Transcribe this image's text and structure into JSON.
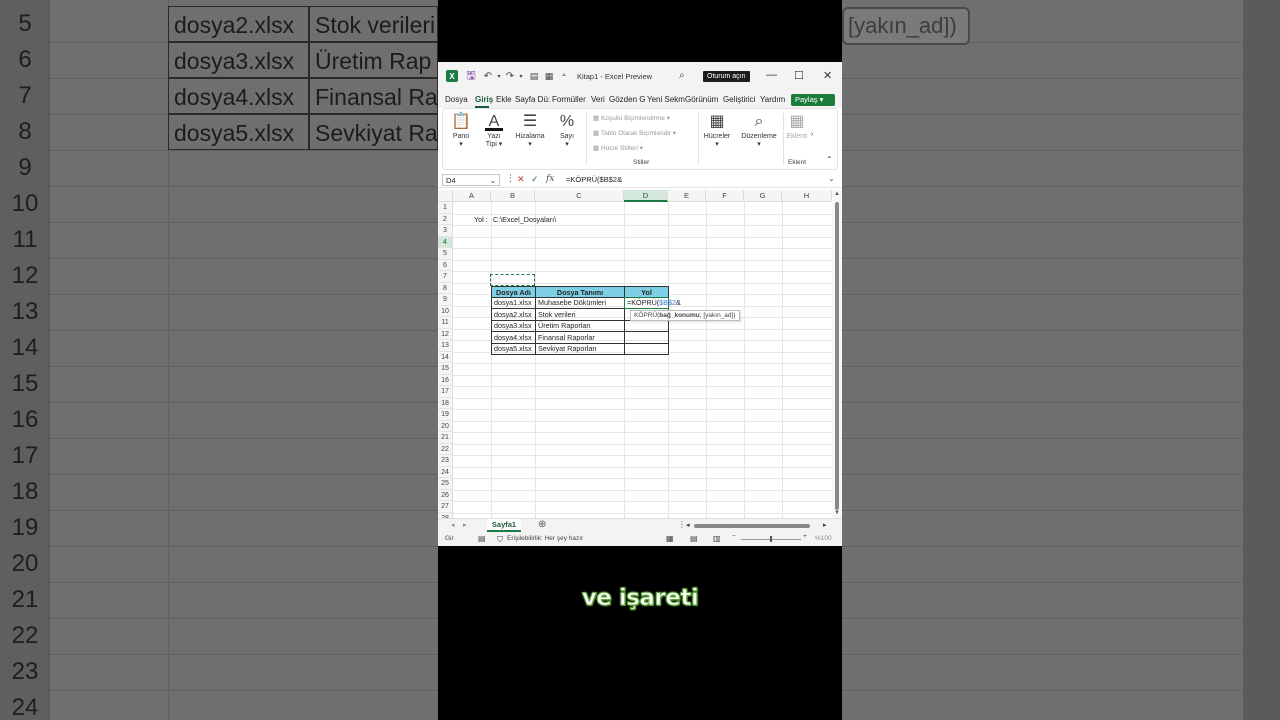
{
  "background": {
    "row_numbers": [
      "5",
      "6",
      "7",
      "8",
      "9",
      "10",
      "11",
      "12",
      "13",
      "14",
      "15",
      "16",
      "17",
      "18",
      "19",
      "20",
      "21",
      "22",
      "23",
      "24"
    ],
    "rows": [
      {
        "file": "dosya2.xlsx",
        "desc": "Stok verileri"
      },
      {
        "file": "dosya3.xlsx",
        "desc": "Üretim Rap"
      },
      {
        "file": "dosya4.xlsx",
        "desc": "Finansal Ra"
      },
      {
        "file": "dosya5.xlsx",
        "desc": "Sevkiyat Ra"
      }
    ],
    "tooltip_fragment": "[yakın_ad])"
  },
  "titlebar": {
    "title": "Kitap1  -  Excel Preview",
    "signin_label": "Oturum açın",
    "minimize": "—",
    "maximize": "☐",
    "close": "✕"
  },
  "menu": {
    "items": [
      "Dosya",
      "Giriş",
      "Ekle",
      "Sayfa Dü:",
      "Formüller",
      "Veri",
      "Gözden G",
      "Yeni Sekm",
      "Görünüm",
      "Geliştirici",
      "Yardım"
    ],
    "share_label": "Paylaş"
  },
  "ribbon": {
    "pano": "Pano",
    "yazi_tipi": "Yazı Tipi",
    "hizalama": "Hizalama",
    "sayi": "Sayı",
    "kosullu": "Koşullu Biçimlendirme",
    "tablo": "Tablo Olarak Biçimlendir",
    "hucre_stilleri": "Hücre Stilleri",
    "stiller": "Stiller",
    "hucreler": "Hücreler",
    "duzenleme": "Düzenleme",
    "eklenti": "Eklenti",
    "eklentiler": "Eklent"
  },
  "formula_bar": {
    "name_box": "D4",
    "formula": "=KÖPRÜ($B$2&"
  },
  "grid": {
    "columns": [
      "A",
      "B",
      "C",
      "D",
      "E",
      "F",
      "G",
      "H"
    ],
    "rows": [
      "1",
      "2",
      "3",
      "4",
      "5",
      "6",
      "7",
      "8",
      "9",
      "10",
      "11",
      "12",
      "13",
      "14",
      "15",
      "16",
      "17",
      "18",
      "19",
      "20",
      "21",
      "22",
      "23",
      "24",
      "25",
      "26",
      "27",
      "28"
    ],
    "yol_label": "Yol :",
    "path_value": "C:\\Excel_Dosyaları\\",
    "table_headers": [
      "Dosya Adı",
      "Dosya Tanımı",
      "Yol"
    ],
    "table_rows": [
      {
        "file": "dosya1.xlsx",
        "desc": "Muhasebe Dökümleri"
      },
      {
        "file": "dosya2.xlsx",
        "desc": "Stok verileri"
      },
      {
        "file": "dosya3.xlsx",
        "desc": "Üretim Raporları"
      },
      {
        "file": "dosya4.xlsx",
        "desc": "Finansal Raporlar"
      },
      {
        "file": "dosya5.xlsx",
        "desc": "Sevkiyat Raporları"
      }
    ],
    "active_cell_prefix": "=KÖPRÜ(",
    "active_cell_ref": "$B$2",
    "active_cell_suffix": "&",
    "tooltip_fn": "KÖPRÜ(",
    "tooltip_arg1": "bağ_konumu",
    "tooltip_arg2": "; [yakın_ad])"
  },
  "sheet_tab": "Sayfa1",
  "status": {
    "mode": "Gir",
    "accessibility": "Erişilebilirlik: Her şey hazır",
    "zoom": "%100"
  },
  "caption": "ve işareti",
  "colors": {
    "excel_green": "#1d7a43",
    "table_header": "#7fd0e7",
    "caption_outline": "#5fa63a"
  }
}
